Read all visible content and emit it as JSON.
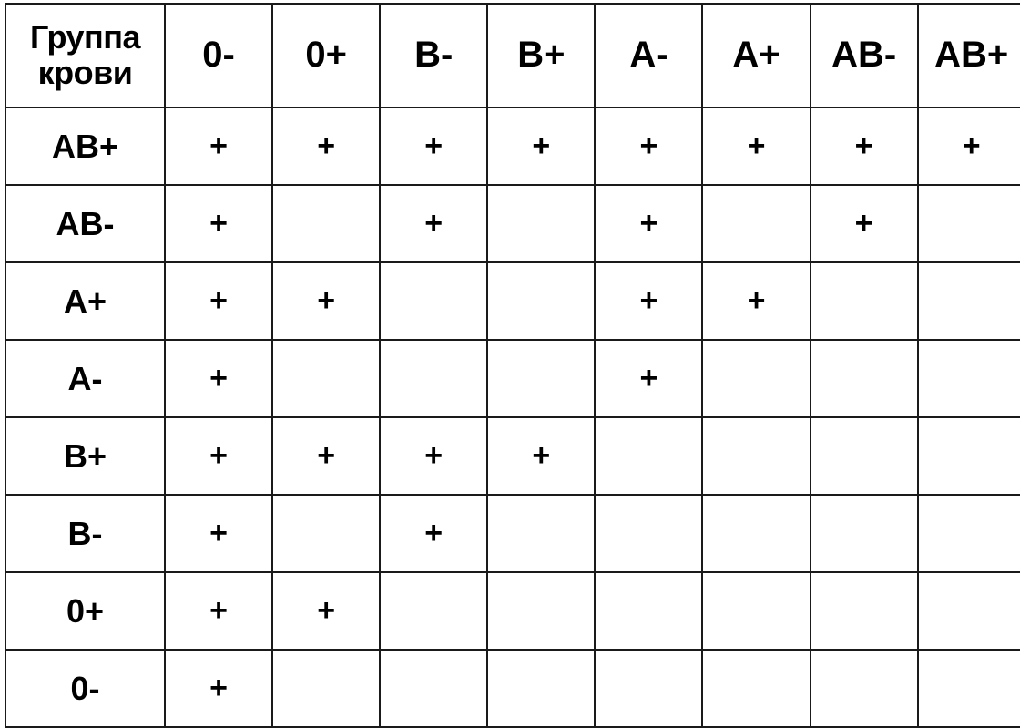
{
  "table": {
    "corner_label_line1": "Группа",
    "corner_label_line2": "крови",
    "mark": "+",
    "blank": "",
    "colors": {
      "header_background": "#dcdcdc",
      "border": "#1a1a1a",
      "text": "#000000",
      "cell_background": "#ffffff"
    },
    "columns": [
      "0-",
      "0+",
      "B-",
      "B+",
      "A-",
      "A+",
      "AB-",
      "AB+"
    ],
    "rows": [
      {
        "label": "AB+",
        "cells": [
          "+",
          "+",
          "+",
          "+",
          "+",
          "+",
          "+",
          "+"
        ]
      },
      {
        "label": "AB-",
        "cells": [
          "+",
          "",
          "+",
          "",
          "+",
          "",
          "+",
          ""
        ]
      },
      {
        "label": "A+",
        "cells": [
          "+",
          "+",
          "",
          "",
          "+",
          "+",
          "",
          ""
        ]
      },
      {
        "label": "A-",
        "cells": [
          "+",
          "",
          "",
          "",
          "+",
          "",
          "",
          ""
        ]
      },
      {
        "label": "B+",
        "cells": [
          "+",
          "+",
          "+",
          "+",
          "",
          "",
          "",
          ""
        ]
      },
      {
        "label": "B-",
        "cells": [
          "+",
          "",
          "+",
          "",
          "",
          "",
          "",
          ""
        ]
      },
      {
        "label": "0+",
        "cells": [
          "+",
          "+",
          "",
          "",
          "",
          "",
          "",
          ""
        ]
      },
      {
        "label": "0-",
        "cells": [
          "+",
          "",
          "",
          "",
          "",
          "",
          "",
          ""
        ]
      }
    ]
  }
}
